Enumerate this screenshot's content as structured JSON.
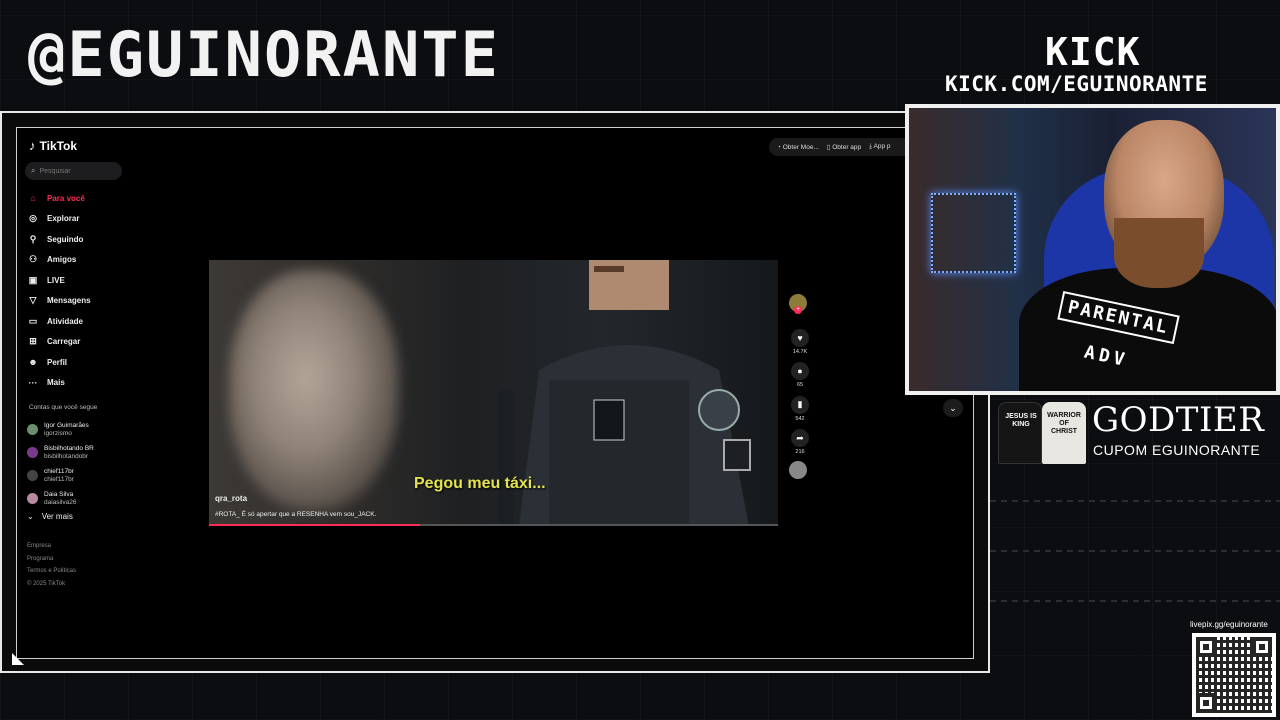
{
  "overlay": {
    "channel_handle": "@EGUINORANTE",
    "platform_logo": "KICK",
    "platform_url": "KICK.COM/EGUINORANTE",
    "sponsor": {
      "brand": "GODTIER",
      "coupon": "CUPOM EGUINORANTE",
      "shirt_black_text": "JESUS IS KING",
      "shirt_white_text": "WARRIOR OF CHRIST"
    },
    "donation": {
      "url": "livepix.gg/eguinorante"
    },
    "webcam": {
      "shirt_text_line1": "PARENTAL",
      "shirt_text_line2": "ADV"
    }
  },
  "tiktok": {
    "logo": "TikTok",
    "search_placeholder": "Pesquisar",
    "nav": [
      {
        "label": "Para você",
        "icon": "home-icon",
        "active": true
      },
      {
        "label": "Explorar",
        "icon": "compass-icon"
      },
      {
        "label": "Seguindo",
        "icon": "following-icon"
      },
      {
        "label": "Amigos",
        "icon": "friends-icon"
      },
      {
        "label": "LIVE",
        "icon": "live-icon"
      },
      {
        "label": "Mensagens",
        "icon": "messages-icon"
      },
      {
        "label": "Atividade",
        "icon": "activity-icon"
      },
      {
        "label": "Carregar",
        "icon": "upload-icon"
      },
      {
        "label": "Perfil",
        "icon": "profile-icon"
      },
      {
        "label": "Mais",
        "icon": "more-icon"
      }
    ],
    "following_title": "Contas que você segue",
    "following": [
      {
        "name": "Igor Guimarães",
        "user": "igorzismo"
      },
      {
        "name": "Bisbilhotando BR",
        "user": "bisbilhotandobr"
      },
      {
        "name": "chief117br",
        "user": "chief117br"
      },
      {
        "name": "Daia Silva",
        "user": "daiasilva26"
      }
    ],
    "see_more": "Ver mais",
    "footer": [
      "Empresa",
      "Programa",
      "Termos e Políticas",
      "© 2025 TikTok"
    ],
    "top_actions": [
      "Obter Moe...",
      "Obter app",
      "App p"
    ],
    "video": {
      "subtitle": "Pegou meu táxi...",
      "author": "qra_rota",
      "caption": "#ROTA_ É só apertar que a RESENHA vem sou_JACK.",
      "progress": 0.37
    },
    "actions": [
      {
        "icon": "heart-icon",
        "count": "14.7K"
      },
      {
        "icon": "comment-icon",
        "count": "65"
      },
      {
        "icon": "bookmark-icon",
        "count": "542"
      },
      {
        "icon": "share-icon",
        "count": "216"
      }
    ]
  }
}
